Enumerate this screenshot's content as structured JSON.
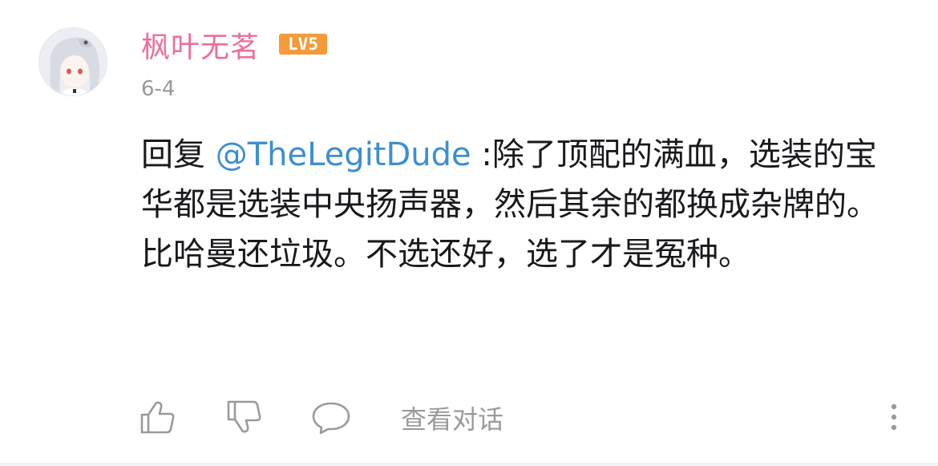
{
  "comment": {
    "username": "枫叶无茗",
    "level_badge": "LV5",
    "date": "6-4",
    "reply_prefix": "回复 ",
    "mention": "@TheLegitDude",
    "body": " :除了顶配的满血，选装的宝华都是选装中央扬声器，然后其余的都换成杂牌的。比哈曼还垃圾。不选还好，选了才是冤种。"
  },
  "actions": {
    "like_icon": "thumbs-up-icon",
    "dislike_icon": "thumbs-down-icon",
    "reply_icon": "comment-bubble-icon",
    "view_conversation_label": "查看对话",
    "more_icon": "more-vertical-icon"
  },
  "colors": {
    "username": "#ee6d9c",
    "mention": "#3d8ed2",
    "badge": "#f49a3a",
    "secondary_text": "#999999"
  }
}
